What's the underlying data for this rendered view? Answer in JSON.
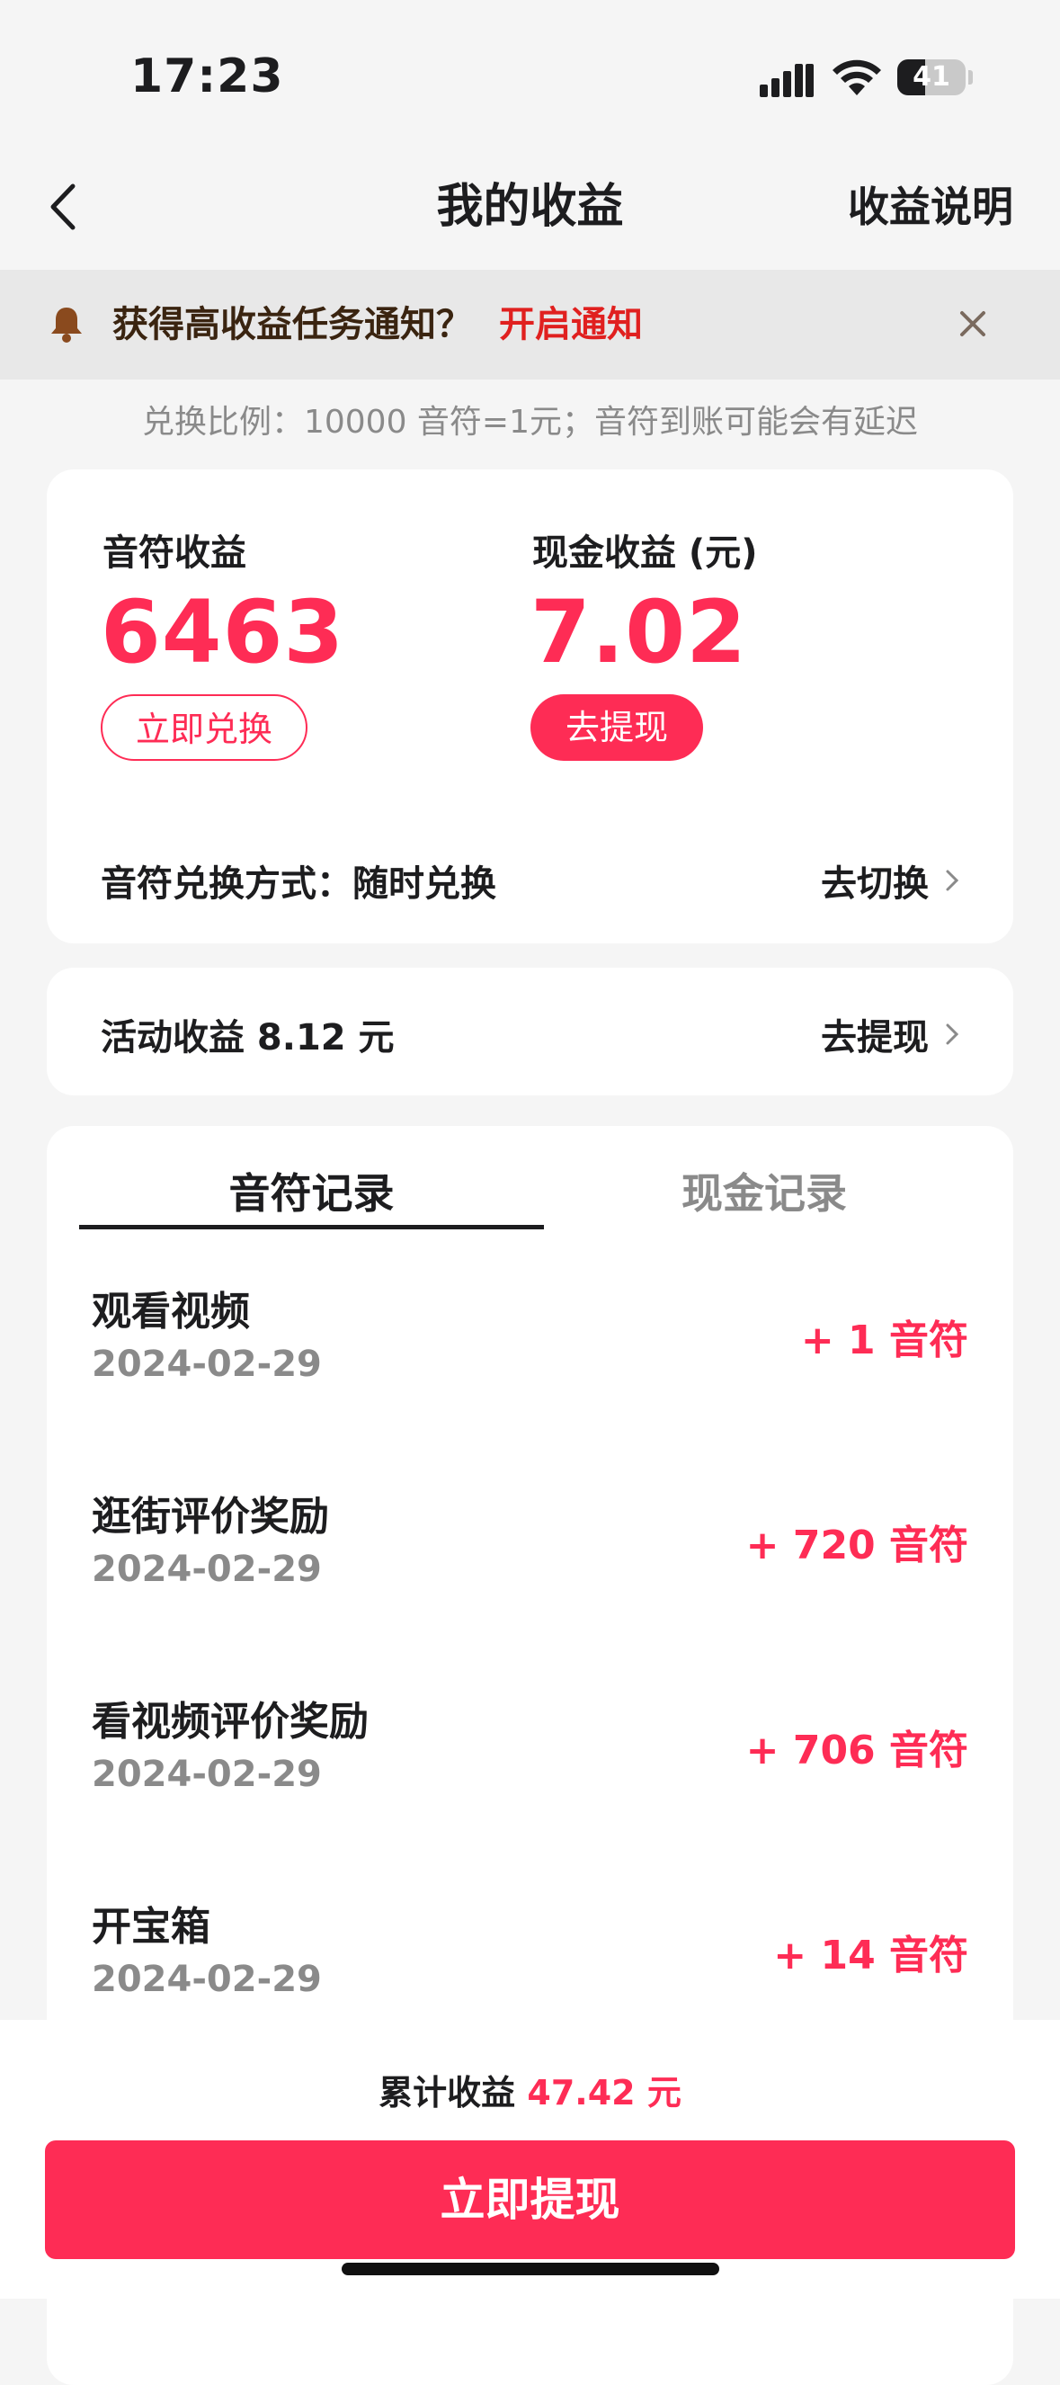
{
  "status_bar": {
    "time": "17:23",
    "battery": "41",
    "battery_level": 0.41
  },
  "nav": {
    "title": "我的收益",
    "right_link": "收益说明",
    "back_icon": "chevron-left-icon"
  },
  "notice": {
    "text": "获得高收益任务通知？",
    "action": "开启通知",
    "icon": "bell-icon",
    "close_icon": "close-icon"
  },
  "exchange_rate": "兑换比例：10000 音符=1元；音符到账可能会有延迟",
  "earnings": {
    "notes_label": "音符收益",
    "notes_value": "6463",
    "exchange_button": "立即兑换",
    "cash_label": "现金收益 (元)",
    "cash_value": "7.02",
    "withdraw_button": "去提现",
    "mode_label": "音符兑换方式：随时兑换",
    "switch_link": "去切换"
  },
  "activity": {
    "label": "活动收益 8.12 元",
    "link": "去提现"
  },
  "tabs": [
    {
      "label": "音符记录",
      "active": true
    },
    {
      "label": "现金记录",
      "active": false
    }
  ],
  "records": [
    {
      "title": "观看视频",
      "date": "2024-02-29",
      "amount": "+ 1 音符"
    },
    {
      "title": "逛街评价奖励",
      "date": "2024-02-29",
      "amount": "+ 720 音符"
    },
    {
      "title": "看视频评价奖励",
      "date": "2024-02-29",
      "amount": "+ 706 音符"
    },
    {
      "title": "开宝箱",
      "date": "2024-02-29",
      "amount": "+ 14 音符"
    }
  ],
  "footer": {
    "total_label": "累计收益",
    "total_value": "47.42 元",
    "button": "立即提现"
  },
  "colors": {
    "accent": "#fe2c55",
    "notice_action": "#e0201f",
    "background": "#f5f5f5"
  }
}
